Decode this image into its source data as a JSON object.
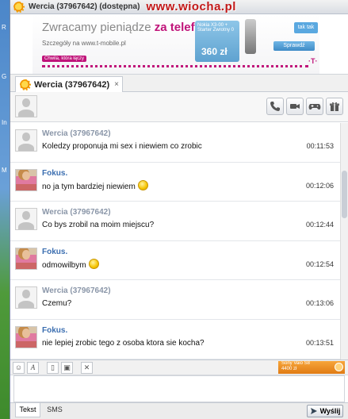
{
  "window": {
    "title": "Wercia (37967642) (dostępna)",
    "watermark_prefix": "www.",
    "watermark_site": "wiocha.pl"
  },
  "banner": {
    "slogan_part1": "Zwracamy pieniądze ",
    "slogan_part2": "za telefon.",
    "details": "Szczegóły na www.t-mobile.pl",
    "chip": "Chwila, która łączy",
    "phone_model": "Nokia X3-00 + Starter Zwrotny 0",
    "price": "360 zł",
    "logo_text": "tak tak",
    "button_label": "Sprawdź",
    "brand_mark": "·T·"
  },
  "tab": {
    "label": "Wercia (37967642)",
    "close": "×"
  },
  "header_buttons": [
    {
      "name": "call-icon"
    },
    {
      "name": "video-icon"
    },
    {
      "name": "gamepad-icon"
    },
    {
      "name": "gift-icon"
    }
  ],
  "messages": [
    {
      "sender": "Wercia (37967642)",
      "type": "other",
      "text": "Koledzy proponuja mi sex i niewiem co zrobic",
      "time": "00:11:53",
      "smiley": false
    },
    {
      "sender": "Fokus.",
      "type": "me",
      "text": "no ja tym bardziej niewiem",
      "time": "00:12:06",
      "smiley": true
    },
    {
      "sender": "Wercia (37967642)",
      "type": "other",
      "text": "Co bys zrobil na moim miejscu?",
      "time": "00:12:44",
      "smiley": false
    },
    {
      "sender": "Fokus.",
      "type": "me",
      "text": "odmowilbym",
      "time": "00:12:54",
      "smiley": true
    },
    {
      "sender": "Wercia (37967642)",
      "type": "other",
      "text": "Czemu?",
      "time": "00:13:06",
      "smiley": false
    },
    {
      "sender": "Fokus.",
      "type": "me",
      "text": "nie lepiej zrobic tego z osoba ktora sie kocha?",
      "time": "00:13:51",
      "smiley": false
    }
  ],
  "toolbar": {
    "font_btn": "A",
    "promo_line1": "Sony Vaio S8",
    "promo_line2": "4400 zł"
  },
  "bottom": {
    "tab_text": "Tekst",
    "tab_sms": "SMS",
    "send_label": "Wyślij"
  },
  "desktop_labels": [
    "R",
    "G",
    "In",
    "M"
  ]
}
